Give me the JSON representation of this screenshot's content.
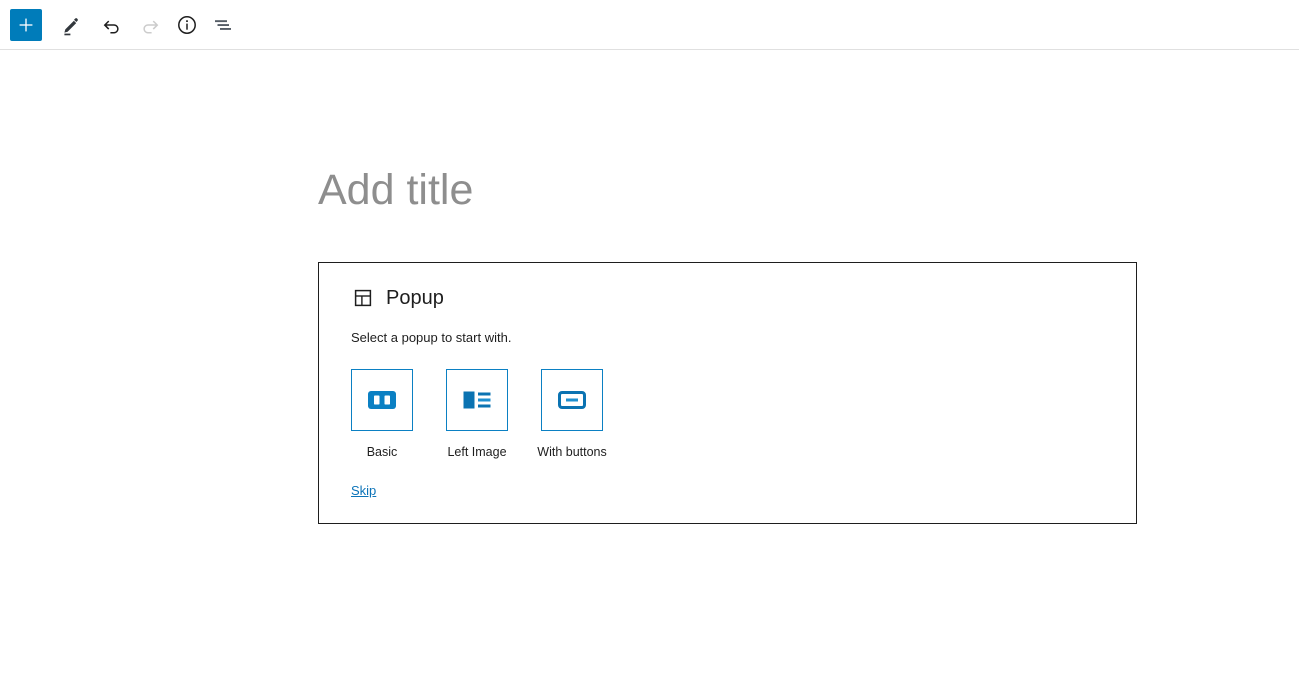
{
  "toolbar": {
    "buttons": [
      {
        "name": "block-inserter",
        "label": "Toggle block inserter",
        "icon": "plus-icon",
        "state": "active"
      },
      {
        "name": "edit-mode",
        "label": "Edit",
        "icon": "pencil-icon",
        "state": "selected"
      },
      {
        "name": "undo",
        "label": "Undo",
        "icon": "undo-arrow-icon",
        "state": "enabled"
      },
      {
        "name": "redo",
        "label": "Redo",
        "icon": "redo-arrow-icon",
        "state": "disabled"
      },
      {
        "name": "details",
        "label": "Details",
        "icon": "info-circle-icon",
        "state": "enabled"
      },
      {
        "name": "list-view",
        "label": "List view",
        "icon": "list-view-icon",
        "state": "enabled"
      }
    ]
  },
  "canvas": {
    "title_placeholder": "Add title"
  },
  "block": {
    "title": "Popup",
    "icon": "layout-template-icon",
    "instructions": "Select a popup to start with.",
    "patterns": [
      {
        "label": "Basic",
        "icon": "pattern-basic-icon"
      },
      {
        "label": "Left Image",
        "icon": "pattern-left-image-icon"
      },
      {
        "label": "With buttons",
        "icon": "pattern-with-buttons-icon"
      }
    ],
    "skip_label": "Skip"
  },
  "colors": {
    "accent_blue": "#007cba",
    "pattern_blue": "#0b80c3",
    "link_blue": "#0b73b8",
    "placeholder_gray": "#8e8e8e",
    "border_dark": "#1e1e1e",
    "border_light": "#e0e0e0"
  }
}
